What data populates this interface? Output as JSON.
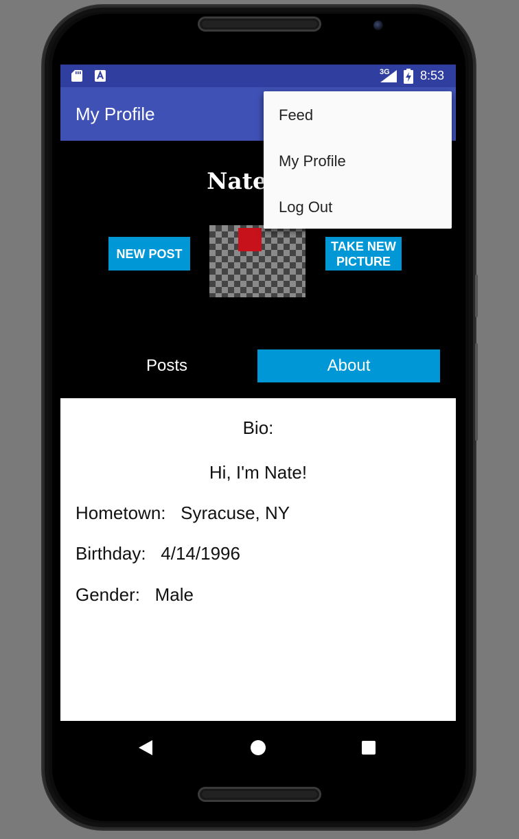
{
  "status_bar": {
    "network": "3G",
    "time": "8:53"
  },
  "app_bar": {
    "title": "My Profile"
  },
  "overflow_menu": {
    "items": [
      "Feed",
      "My Profile",
      "Log Out"
    ]
  },
  "profile": {
    "name": "Nate Cu",
    "new_post_label": "NEW POST",
    "take_picture_label_line1": "TAKE NEW",
    "take_picture_label_line2": "PICTURE"
  },
  "tabs": [
    {
      "label": "Posts",
      "selected": false
    },
    {
      "label": "About",
      "selected": true
    }
  ],
  "about": {
    "bio_label": "Bio:",
    "bio_text": "Hi, I'm Nate!",
    "hometown_label": "Hometown:",
    "hometown": "Syracuse, NY",
    "birthday_label": "Birthday:",
    "birthday": "4/14/1996",
    "gender_label": "Gender:",
    "gender": "Male"
  },
  "colors": {
    "status_bar": "#303f9f",
    "app_bar": "#3f51b5",
    "accent": "#0097d6",
    "pic_marker": "#c8121b"
  }
}
